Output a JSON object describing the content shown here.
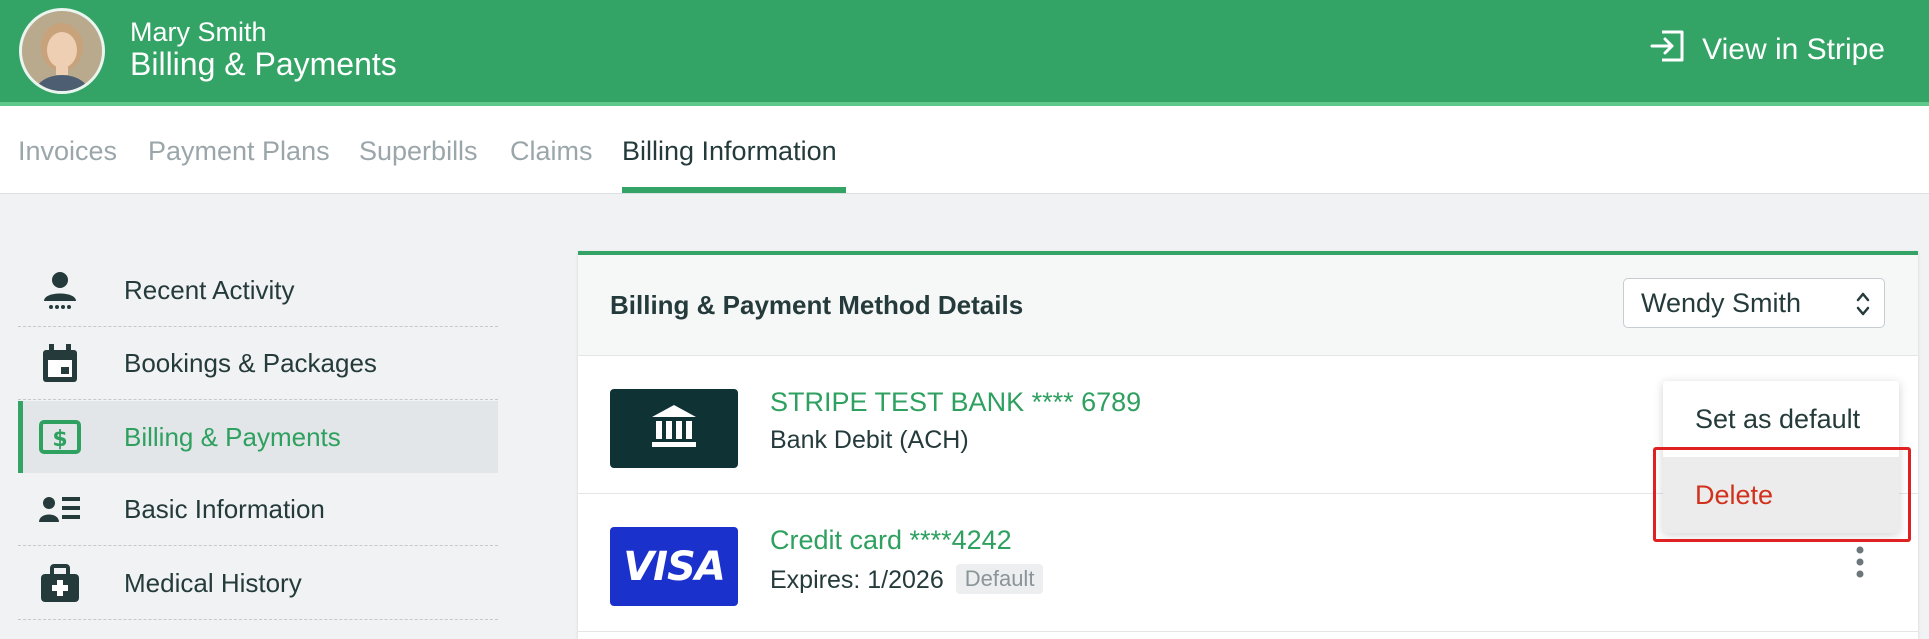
{
  "header": {
    "user_name": "Mary Smith",
    "page_title": "Billing & Payments",
    "stripe_button_label": "View in Stripe",
    "accent_color": "#33a465"
  },
  "tabs": [
    {
      "label": "Invoices",
      "active": false
    },
    {
      "label": "Payment Plans",
      "active": false
    },
    {
      "label": "Superbills",
      "active": false
    },
    {
      "label": "Claims",
      "active": false
    },
    {
      "label": "Billing Information",
      "active": true
    }
  ],
  "sidebar": {
    "items": [
      {
        "label": "Recent Activity",
        "icon": "person-icon"
      },
      {
        "label": "Bookings & Packages",
        "icon": "calendar-icon"
      },
      {
        "label": "Billing & Payments",
        "icon": "dollar-bill-icon",
        "active": true
      },
      {
        "label": "Basic Information",
        "icon": "contact-list-icon"
      },
      {
        "label": "Medical History",
        "icon": "medical-bag-icon"
      }
    ]
  },
  "panel": {
    "title": "Billing & Payment Method Details",
    "client_select": {
      "selected": "Wendy Smith"
    },
    "payment_methods": [
      {
        "name": "STRIPE TEST BANK **** 6789",
        "subtitle": "Bank Debit (ACH)",
        "logo": "bank-icon"
      },
      {
        "name": "Credit card ****4242",
        "subtitle": "Expires: 1/2026",
        "badge": "Default",
        "logo": "VISA"
      }
    ]
  },
  "menu": {
    "items": [
      {
        "label": "Set as default"
      },
      {
        "label": "Delete",
        "color": "#d1321d"
      }
    ]
  }
}
